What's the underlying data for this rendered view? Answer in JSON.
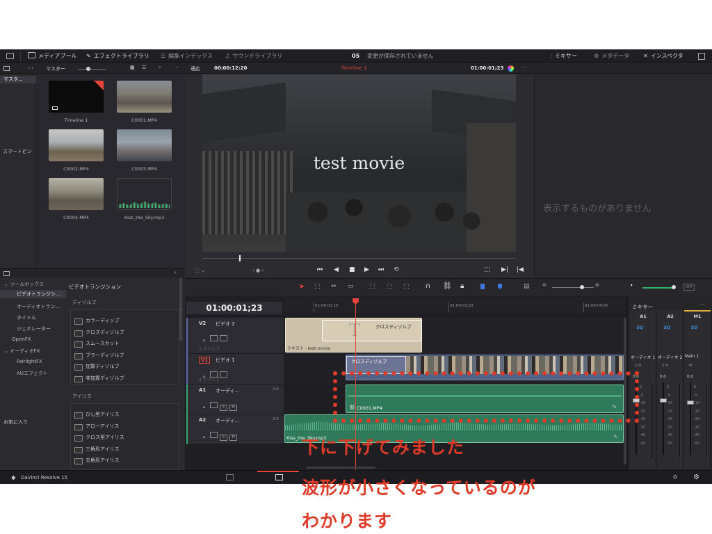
{
  "header": {
    "media_pool": "メディアプール",
    "effects_library": "エフェクトライブラリ",
    "edit_index": "編集インデックス",
    "sound_library": "サウンドライブラリ",
    "project_number": "05",
    "save_status": "変更が保存されていません",
    "mixer": "ミキサー",
    "metadata": "メタデータ",
    "inspector": "インスペクタ"
  },
  "subbar": {
    "master": "マスター",
    "fit": "適応",
    "source_tc": "00:00:12:20",
    "timeline_name": "Timeline 1",
    "record_tc": "01:00:01;23"
  },
  "bins": {
    "master": "マスタ...",
    "smart_bins": "スマートビン"
  },
  "media": [
    {
      "name": "Timeline 1",
      "kind": "timeline"
    },
    {
      "name": "C0001.MP4",
      "kind": "video"
    },
    {
      "name": "C0002.MP4",
      "kind": "video"
    },
    {
      "name": "C0003.MP4",
      "kind": "video"
    },
    {
      "name": "C0004.MP4",
      "kind": "video"
    },
    {
      "name": "Kiss_the_Sky.mp3",
      "kind": "audio"
    }
  ],
  "viewer": {
    "overlay_text": "test movie",
    "inspector_empty": "表示するものがありません"
  },
  "effects": {
    "toolbox": "ツールボックス",
    "video_transitions": "ビデオトランジシ...",
    "audio_transitions": "オーディオトラン...",
    "titles": "タイトル",
    "generators": "ジェネレーター",
    "openfx": "OpenFX",
    "audiofx": "オーディオFX",
    "fairlightfx": "FairlightFX",
    "au_effects": "AUエフェクト",
    "favorites": "お気に入り"
  },
  "transitions": {
    "header": "ビデオトランジション",
    "dissolve_group": "ディゾルブ",
    "dissolve": [
      "カラーディップ",
      "クロスディゾルブ",
      "スムースカット",
      "ブラーディゾルブ",
      "加算ディゾルブ",
      "非加算ディゾルブ"
    ],
    "iris_group": "アイリス",
    "iris": [
      "ひし型アイリス",
      "アローアイリス",
      "クロス型アイリス",
      "三角形アイリス",
      "五角形アイリス"
    ]
  },
  "timeline": {
    "timecode": "01:00:01;23",
    "ruler": [
      "01:00:01;10",
      "01:00:02;20",
      "01:00:04;00"
    ],
    "tracks": [
      {
        "id": "V2",
        "name": "ビデオ 2",
        "clips": "2 クリップ"
      },
      {
        "id": "V1",
        "name": "ビデオ 1",
        "clips": "4 クリップ"
      },
      {
        "id": "A1",
        "name": "オーディ...",
        "level": "2.0"
      },
      {
        "id": "A2",
        "name": "オーディ...",
        "level": "2.0"
      }
    ],
    "v2_clip_label": "テキスト - test movie",
    "v2_transition": "クロスディゾルブ",
    "v1_transition": "クロスディゾルブ",
    "a1_clip": "C0001.MP4",
    "a2_clip": "Kiss_the_Sky.mp3",
    "s_label": "S",
    "m_label": "M"
  },
  "mixer": {
    "title": "ミキサー",
    "channels": [
      "A1",
      "A2",
      "M1"
    ],
    "eq": "EQ",
    "bus_labels": [
      "オーディオ 1",
      "オーディオ 2",
      "Main 1"
    ],
    "values": [
      "0.0",
      "0.0",
      "0.0"
    ],
    "db_scale": [
      "0",
      "-5",
      "-10",
      "-15",
      "-20",
      "-30",
      "-40",
      "-50"
    ],
    "dim": "DIM"
  },
  "footer": {
    "app_name": "DaVinci Resolve 15"
  },
  "annotation": {
    "line1": "下に下げてみました",
    "line2": "波形が小さくなっているのが",
    "line3": "わかります"
  },
  "colors": {
    "accent_red": "#e03a28",
    "video_clip": "#3f4f72",
    "audio_clip": "#2e7a5a",
    "title_clip": "#c8bba4",
    "playhead": "#e8463a"
  }
}
